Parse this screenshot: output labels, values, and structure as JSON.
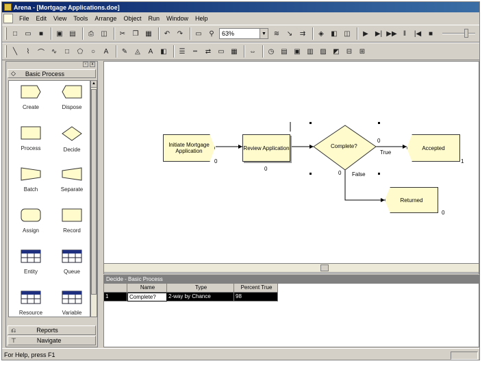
{
  "window": {
    "title": "Arena - [Mortgage Applications.doe]"
  },
  "menu": [
    "File",
    "Edit",
    "View",
    "Tools",
    "Arrange",
    "Object",
    "Run",
    "Window",
    "Help"
  ],
  "toolbar": {
    "zoom_value": "63%"
  },
  "panel": {
    "header": "Basic Process",
    "modules": [
      {
        "label": "Create",
        "shape": "create"
      },
      {
        "label": "Dispose",
        "shape": "dispose"
      },
      {
        "label": "Process",
        "shape": "process"
      },
      {
        "label": "Decide",
        "shape": "decide"
      },
      {
        "label": "Batch",
        "shape": "batch"
      },
      {
        "label": "Separate",
        "shape": "separate"
      },
      {
        "label": "Assign",
        "shape": "assign"
      },
      {
        "label": "Record",
        "shape": "record"
      },
      {
        "label": "Entity",
        "shape": "table"
      },
      {
        "label": "Queue",
        "shape": "table"
      },
      {
        "label": "Resource",
        "shape": "table"
      },
      {
        "label": "Variable",
        "shape": "table"
      }
    ],
    "footer_reports": "Reports",
    "footer_navigate": "Navigate"
  },
  "flowchart": {
    "create": {
      "label": "Initiate Mortgage Application",
      "count": "0"
    },
    "process": {
      "label": "Review Application",
      "count": "0"
    },
    "decide": {
      "label": "Complete?",
      "count_top": "0",
      "count_bottom": "0",
      "true_label": "True",
      "false_label": "False"
    },
    "accepted": {
      "label": "Accepted",
      "count": "1"
    },
    "returned": {
      "label": "Returned",
      "count": "0"
    }
  },
  "grid": {
    "title": "Decide - Basic Process",
    "columns": [
      "Name",
      "Type",
      "Percent True"
    ],
    "rows": [
      {
        "index": "1",
        "name": "Complete?",
        "type": "2-way by Chance",
        "percent": "98"
      }
    ]
  },
  "status": {
    "text": "For Help, press F1"
  }
}
